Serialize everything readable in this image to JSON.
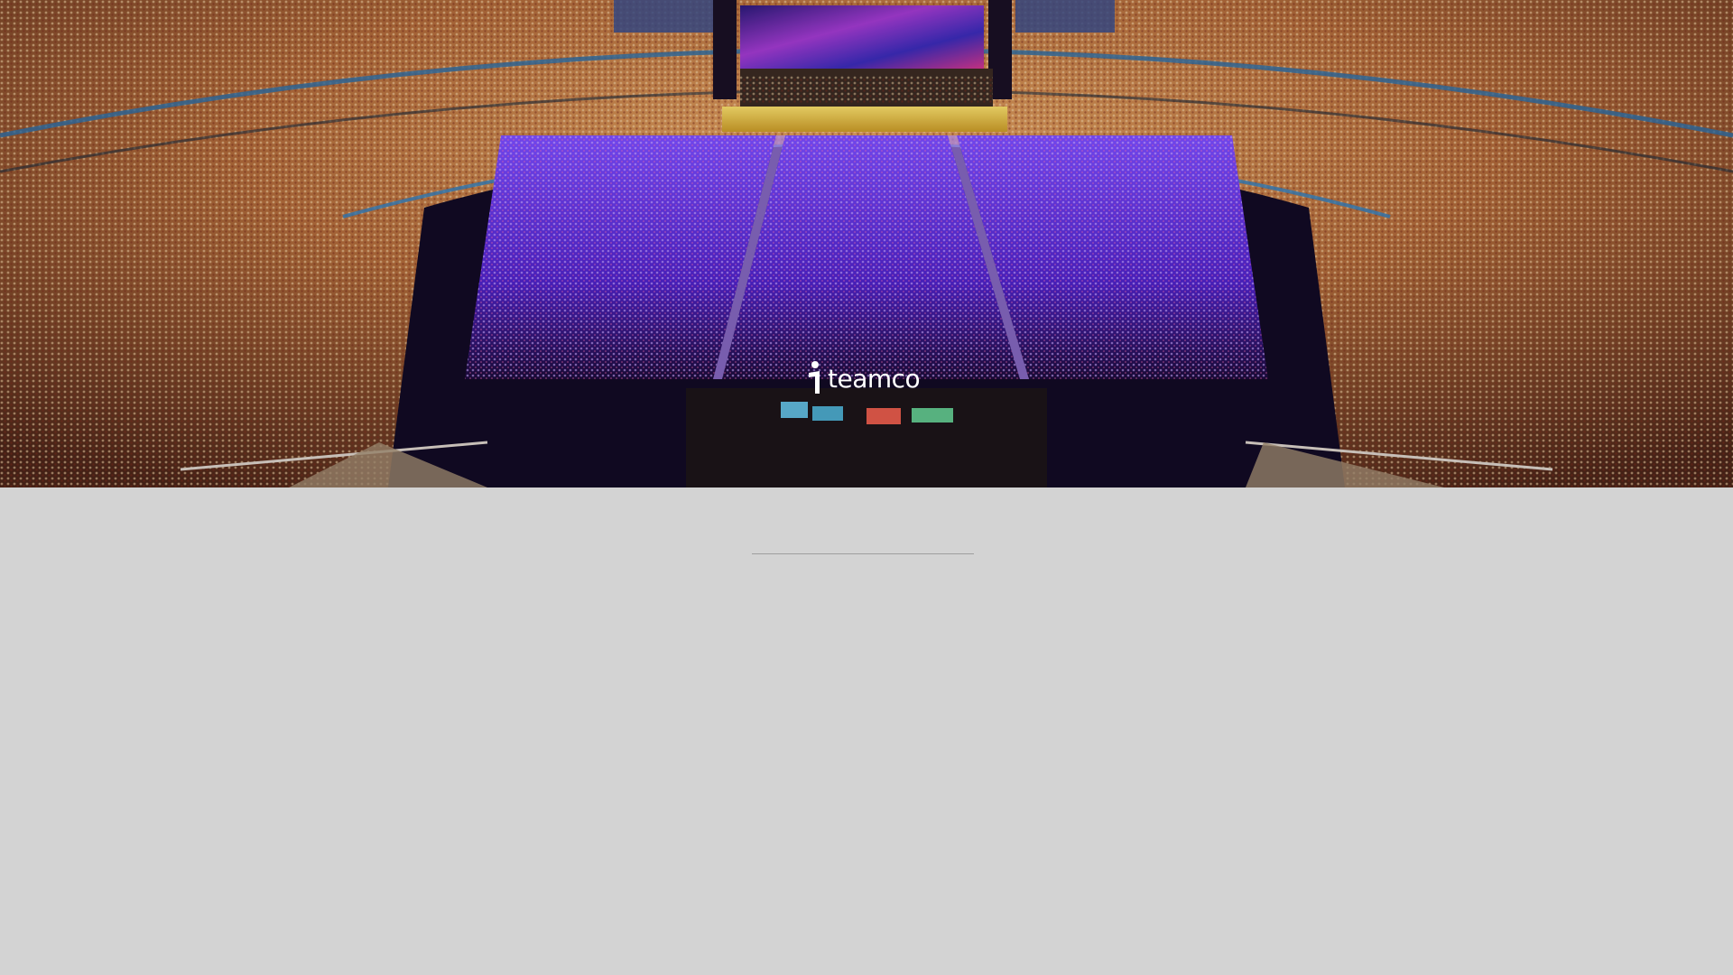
{
  "hero": {
    "image_subject": "arena-concert-crowd",
    "logo": {
      "text": "teamco",
      "icon": "teamco-logo-icon",
      "color": "#ffffff"
    }
  },
  "colors": {
    "page_background": "#d3d3d3",
    "divider": "#9e9e9e",
    "floor_seating_accent": "#6a3cf0",
    "stands_warm": "#c98a4a"
  }
}
